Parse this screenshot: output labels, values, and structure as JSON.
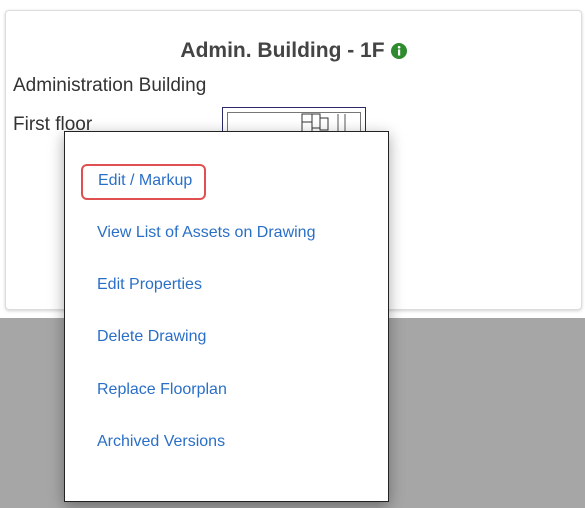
{
  "card": {
    "title": "Admin. Building - 1F",
    "building": "Administration Building",
    "floor": "First floor"
  },
  "context_menu": {
    "items": [
      {
        "label": "Edit / Markup"
      },
      {
        "label": "View List of Assets on Drawing"
      },
      {
        "label": "Edit Properties"
      },
      {
        "label": "Delete Drawing"
      },
      {
        "label": "Replace Floorplan"
      },
      {
        "label": "Archived Versions"
      }
    ]
  },
  "colors": {
    "link": "#2a6fc7",
    "highlight_border": "#e05050",
    "info_icon": "#2e8b2e",
    "overlay_gray": "#a6a6a6"
  }
}
